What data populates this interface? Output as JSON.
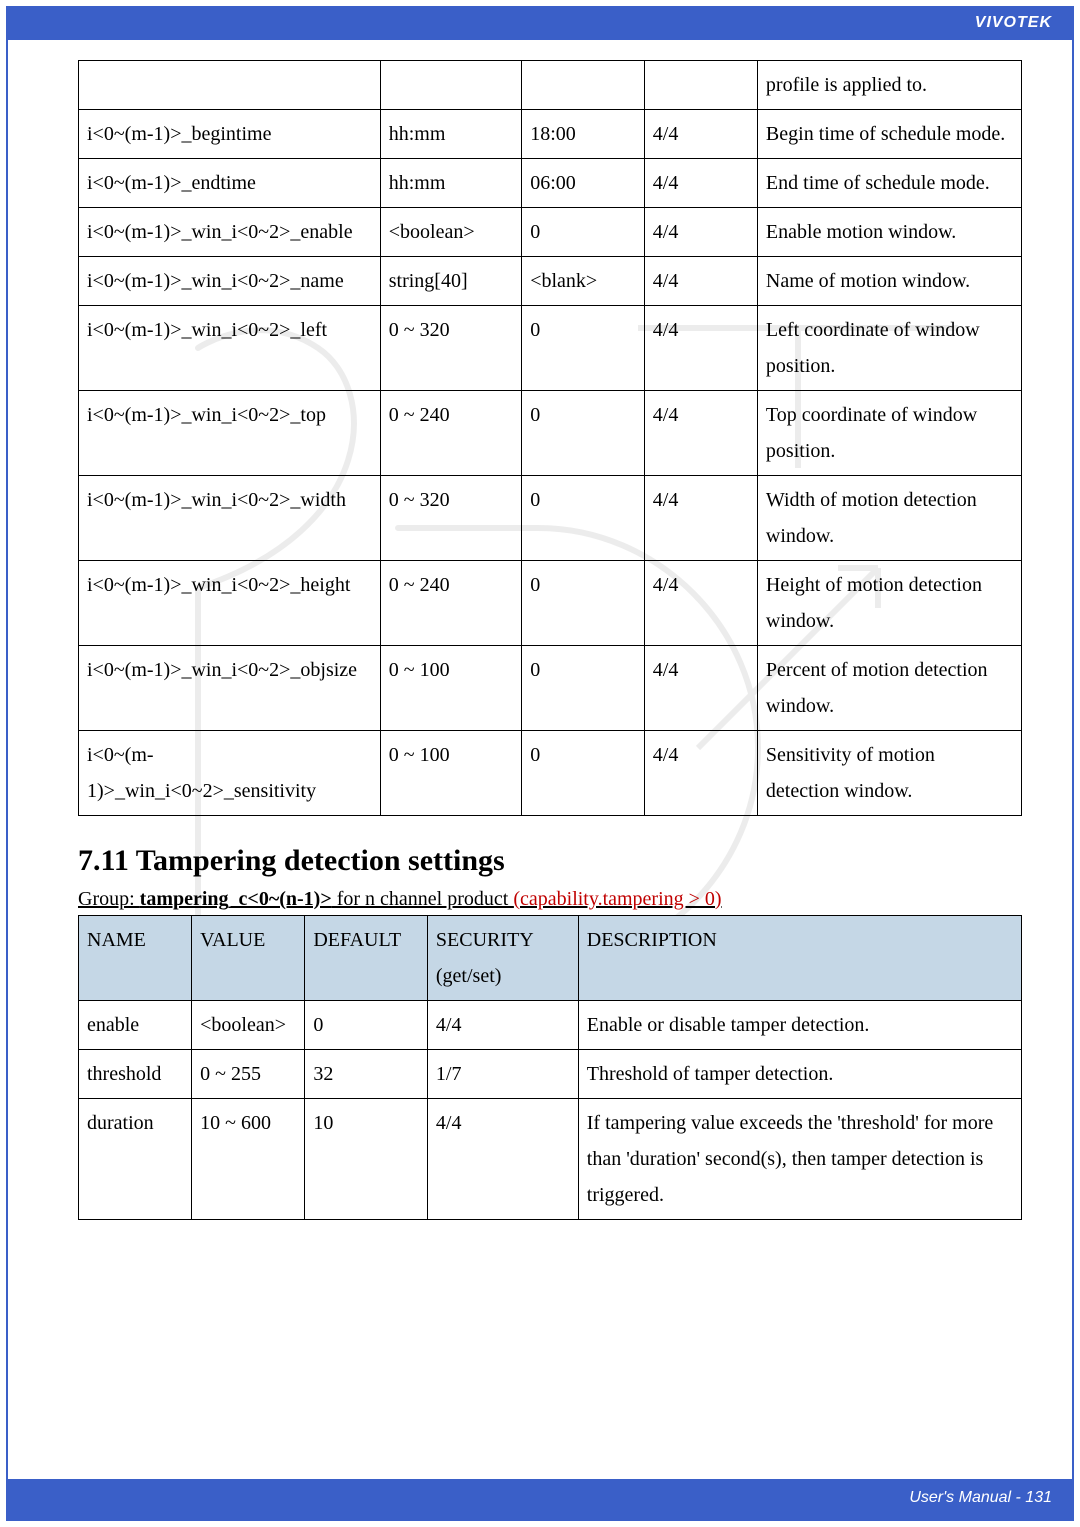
{
  "brand": "VIVOTEK",
  "footer": "User's Manual - 131",
  "main_table": {
    "prev_tail": "profile is applied to.",
    "rows": [
      {
        "name": "i<0~(m-1)>_begintime",
        "value": "hh:mm",
        "default": "18:00",
        "security": "4/4",
        "desc": "Begin time of schedule mode."
      },
      {
        "name": "i<0~(m-1)>_endtime",
        "value": "hh:mm",
        "default": "06:00",
        "security": "4/4",
        "desc": "End time of schedule mode."
      },
      {
        "name": "i<0~(m-1)>_win_i<0~2>_enable",
        "value": "<boolean>",
        "default": "0",
        "security": "4/4",
        "desc": "Enable motion window."
      },
      {
        "name": "i<0~(m-1)>_win_i<0~2>_name",
        "value": "string[40]",
        "default": "<blank>",
        "security": "4/4",
        "desc": "Name of motion window."
      },
      {
        "name": "i<0~(m-1)>_win_i<0~2>_left",
        "value": "0 ~ 320",
        "default": "0",
        "security": "4/4",
        "desc": "Left coordinate of window position."
      },
      {
        "name": "i<0~(m-1)>_win_i<0~2>_top",
        "value": "0 ~ 240",
        "default": "0",
        "security": "4/4",
        "desc": "Top coordinate of window position."
      },
      {
        "name": "i<0~(m-1)>_win_i<0~2>_width",
        "value": "0 ~ 320",
        "default": "0",
        "security": "4/4",
        "desc": "Width of motion detection window."
      },
      {
        "name": "i<0~(m-1)>_win_i<0~2>_height",
        "value": "0 ~ 240",
        "default": "0",
        "security": "4/4",
        "desc": "Height of motion detection window."
      },
      {
        "name": "i<0~(m-1)>_win_i<0~2>_objsize",
        "value": "0 ~ 100",
        "default": "0",
        "security": "4/4",
        "desc": "Percent of motion detection window."
      },
      {
        "name": "i<0~(m-1)>_win_i<0~2>_sensitivity",
        "value": "0 ~ 100",
        "default": "0",
        "security": "4/4",
        "desc": "Sensitivity of motion detection window."
      }
    ]
  },
  "section_heading": "7.11 Tampering detection settings",
  "group_prefix": "Group: ",
  "group_bold": "tampering_c<0~(n-1)>",
  "group_mid": " for n channel product ",
  "group_red": "(capability.tampering > 0)",
  "sub_table": {
    "headers": {
      "name": "NAME",
      "value": "VALUE",
      "default": "DEFAULT",
      "security": "SECURITY (get/set)",
      "desc": "DESCRIPTION"
    },
    "rows": [
      {
        "name": "enable",
        "value": "<boolean>",
        "default": "0",
        "security": "4/4",
        "desc": "Enable or disable tamper detection."
      },
      {
        "name": "threshold",
        "value": "0 ~ 255",
        "default": "32",
        "security": "1/7",
        "desc": "Threshold of tamper detection."
      },
      {
        "name": "duration",
        "value": "10 ~ 600",
        "default": "10",
        "security": "4/4",
        "desc": "If tampering value exceeds the 'threshold' for more than 'duration' second(s), then tamper detection is triggered."
      }
    ]
  }
}
